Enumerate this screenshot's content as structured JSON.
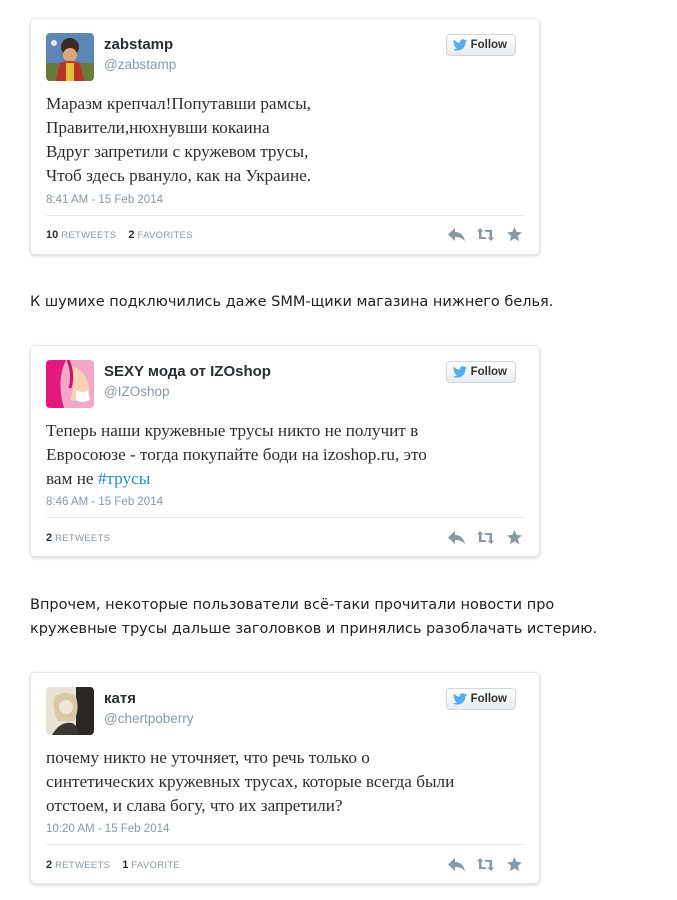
{
  "tweets": [
    {
      "name": "zabstamp",
      "handle": "@zabstamp",
      "follow_label": "Follow",
      "text_lines": [
        "Маразм крепчал!Попутавши рамсы,",
        "Правители,нюхнувши кокаина",
        "Вдруг запретили с кружевом трусы,",
        "Чтоб здесь рвануло, как на Украине."
      ],
      "time": "8:41 AM - 15 Feb 2014",
      "retweets_count": "10",
      "retweets_label": "RETWEETS",
      "favorites_count": "2",
      "favorites_label": "FAVORITES"
    },
    {
      "name": "SEXY мода от IZOshop",
      "handle": "@IZOshop",
      "follow_label": "Follow",
      "text_lines": [
        "Теперь наши кружевные трусы никто не получит в",
        "Евросоюзе - тогда покупайте боди на izoshop.ru, это"
      ],
      "text_last_prefix": "вам не ",
      "text_hashtag": "#трусы",
      "time": "8:46 AM - 15 Feb 2014",
      "retweets_count": "2",
      "retweets_label": "RETWEETS"
    },
    {
      "name": "катя",
      "handle": "@chertpoberry",
      "follow_label": "Follow",
      "text_lines": [
        "почему никто не уточняет, что речь только о",
        "синтетических кружевных трусах, которые всегда были",
        "отстоем, и слава богу, что их запретили?"
      ],
      "time": "10:20 AM - 15 Feb 2014",
      "retweets_count": "2",
      "retweets_label": "RETWEETS",
      "favorites_count": "1",
      "favorites_label": "FAVORITE"
    }
  ],
  "paragraphs": [
    [
      "К шумихе подключились даже SMM-щики магазина нижнего белья."
    ],
    [
      "Впрочем, некоторые пользователи всё-таки прочитали новости про",
      "кружевные трусы дальше заголовков и принялись разоблачать истерию."
    ]
  ],
  "colors": {
    "twitter_blue": "#55acee",
    "hashtag": "#2b8bc6",
    "muted": "#8899a6"
  },
  "icons": [
    "twitter-bird-icon",
    "reply-icon",
    "retweet-icon",
    "favorite-star-icon"
  ]
}
